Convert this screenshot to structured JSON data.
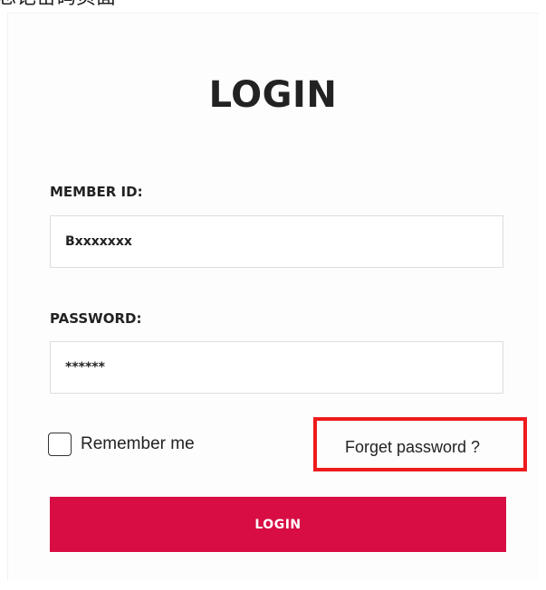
{
  "top_strip_text": "忘记密码页面",
  "title": "LOGIN",
  "member_id": {
    "label": "MEMBER ID:",
    "value": "Bxxxxxxx"
  },
  "password": {
    "label": "PASSWORD:",
    "value": "******"
  },
  "remember_me": {
    "label": "Remember me",
    "checked": false
  },
  "forgot_password": {
    "label": "Forget password ?",
    "highlight_color": "#ee1c1c"
  },
  "login_button": {
    "label": "LOGIN",
    "color": "#d80d44"
  }
}
